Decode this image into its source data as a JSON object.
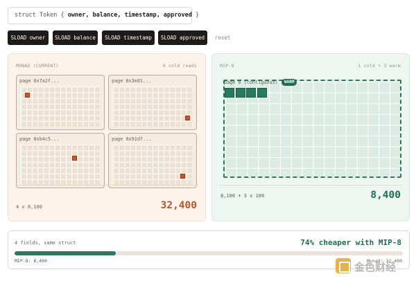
{
  "struct_decl": {
    "prefix": "struct Token { ",
    "fields": "owner, balance, timestamp, approved",
    "suffix": " }"
  },
  "buttons": {
    "sload_owner": "SLOAD owner",
    "sload_balance": "SLOAD balance",
    "sload_timestamp": "SLOAD timestamp",
    "sload_approved": "SLOAD approved",
    "reset": "reset"
  },
  "monad": {
    "title": "MONAD (CURRENT)",
    "reads": "4 cold reads",
    "pages": [
      {
        "label": "page 0x7a2f..."
      },
      {
        "label": "page 0x3e81..."
      },
      {
        "label": "page 0xb4c5..."
      },
      {
        "label": "page 0x91d7..."
      }
    ],
    "calc": "4 x 8,100",
    "total": "32,400"
  },
  "mip8": {
    "title": "MIP-8",
    "reads": "1 cold + 3 warm",
    "page_label": "page 0 (contiguous)",
    "badge": "WARM",
    "warm_slots": 4,
    "calc": "8,100 + 3 x 100",
    "total": "8,400"
  },
  "summary": {
    "left": "4 fields, same struct",
    "right": "74% cheaper with MIP-8",
    "mip_label": "MIP-8: 8,400",
    "monad_label": "Monad: 32,400",
    "progress_fraction": 0.26
  },
  "watermark": {
    "text": "金色财经",
    "logo_color": "#e4b34a"
  },
  "colors": {
    "monad_accent": "#b5562b",
    "mip_accent": "#1f6b54",
    "hot_slot": "#c1582c",
    "warm_slot": "#2a7a62"
  }
}
